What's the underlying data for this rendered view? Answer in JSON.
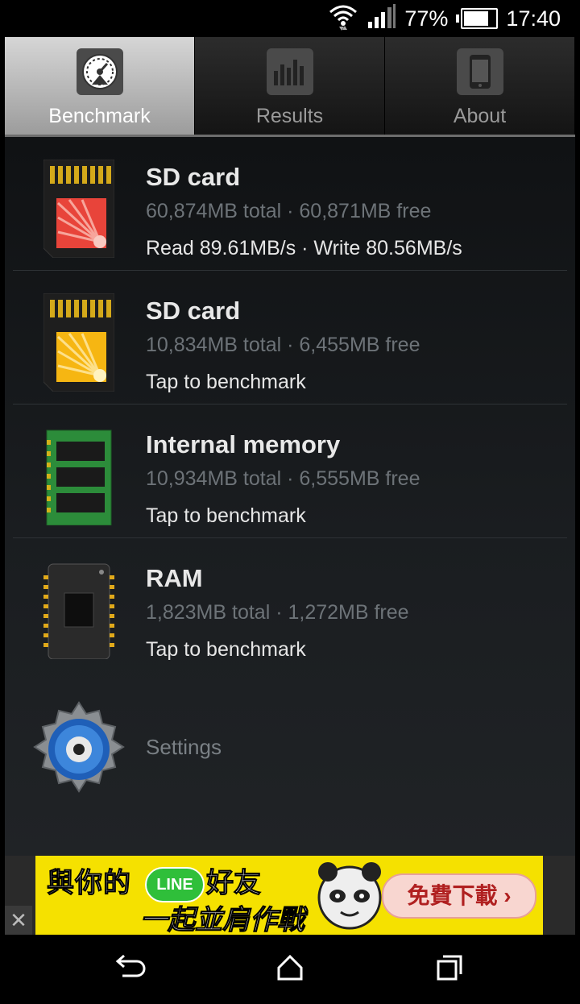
{
  "status_bar": {
    "battery_percent": "77%",
    "battery_level": 0.77,
    "time": "17:40"
  },
  "tabs": [
    {
      "label": "Benchmark",
      "icon": "gauge-icon",
      "active": true
    },
    {
      "label": "Results",
      "icon": "bar-chart-icon",
      "active": false
    },
    {
      "label": "About",
      "icon": "phone-icon",
      "active": false
    }
  ],
  "items": [
    {
      "title": "SD card",
      "subtitle": "60,874MB total · 60,871MB free",
      "status": "Read 89.61MB/s · Write 80.56MB/s",
      "icon": "sd-card-red-icon"
    },
    {
      "title": "SD card",
      "subtitle": "10,834MB total · 6,455MB free",
      "status": "Tap to benchmark",
      "icon": "sd-card-yellow-icon"
    },
    {
      "title": "Internal memory",
      "subtitle": "10,934MB total · 6,555MB free",
      "status": "Tap to benchmark",
      "icon": "memory-chip-icon"
    },
    {
      "title": "RAM",
      "subtitle": "1,823MB total · 1,272MB free",
      "status": "Tap to benchmark",
      "icon": "ram-chip-icon"
    }
  ],
  "settings": {
    "label": "Settings",
    "icon": "gear-icon"
  },
  "ad": {
    "line1_a": "與你的",
    "line_badge": "LINE",
    "line1_b": "好友",
    "line2": "一起並肩作戰",
    "button": "免費下載 ›",
    "close": "✕"
  },
  "colors": {
    "active_tab": "#bdbdbd",
    "list_bg": "#15181b",
    "ad_bg": "#f5e100"
  }
}
